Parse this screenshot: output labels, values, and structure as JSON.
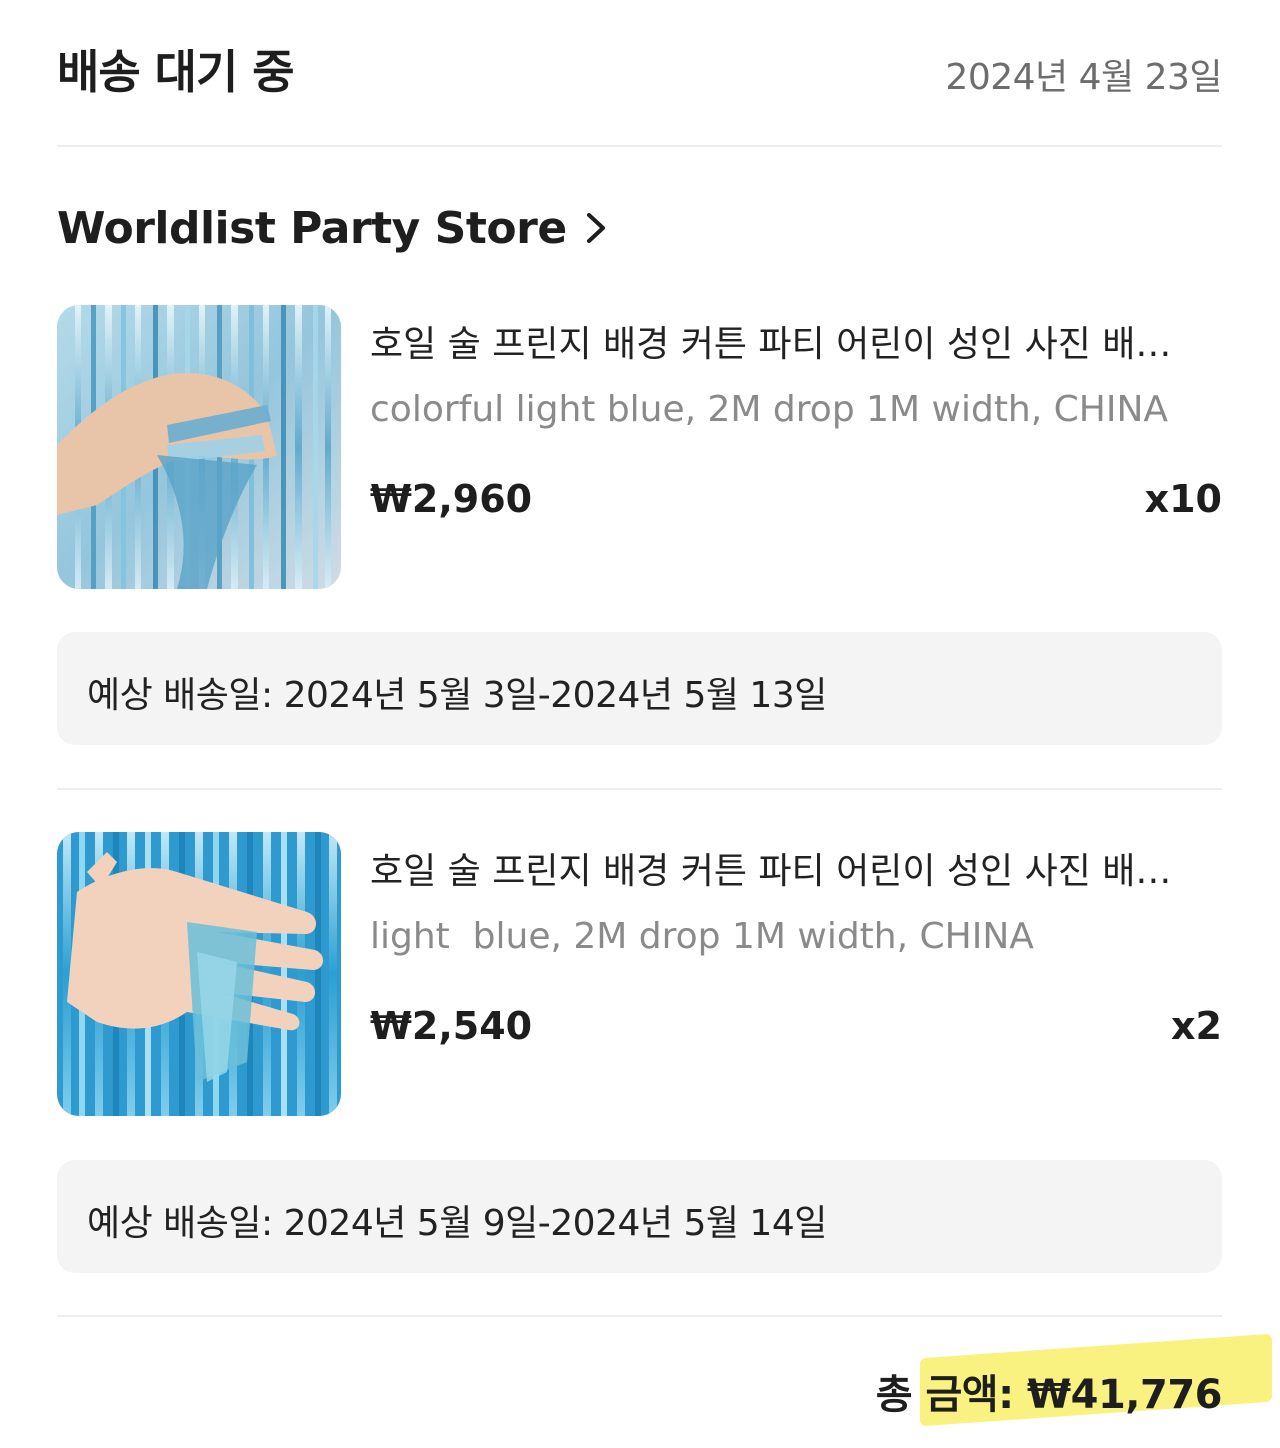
{
  "header": {
    "status": "배송 대기 중",
    "date": "2024년 4월 23일"
  },
  "store": {
    "name": "Worldlist Party Store",
    "icon": "chevron-right-icon"
  },
  "items": [
    {
      "title": "호일 술 프린지 배경 커튼 파티 어린이 성인 사진 배경 장식 생일 웨딩",
      "variant": "colorful light blue, 2M drop 1M width, CHINA",
      "price": "₩2,960",
      "quantity": "x10",
      "estimated_delivery": "예상 배송일: 2024년 5월 3일-2024년 5월 13일"
    },
    {
      "title": "호일 술 프린지 배경 커튼 파티 어린이 성인 사진 배경 장식 생일 웨딩",
      "variant": "light  blue, 2M drop 1M width, CHINA",
      "price": "₩2,540",
      "quantity": "x2",
      "estimated_delivery": "예상 배송일: 2024년 5월 9일-2024년 5월 14일"
    }
  ],
  "total": {
    "text": "총 금액: ₩41,776",
    "highlight_color": "#f8f06a"
  }
}
